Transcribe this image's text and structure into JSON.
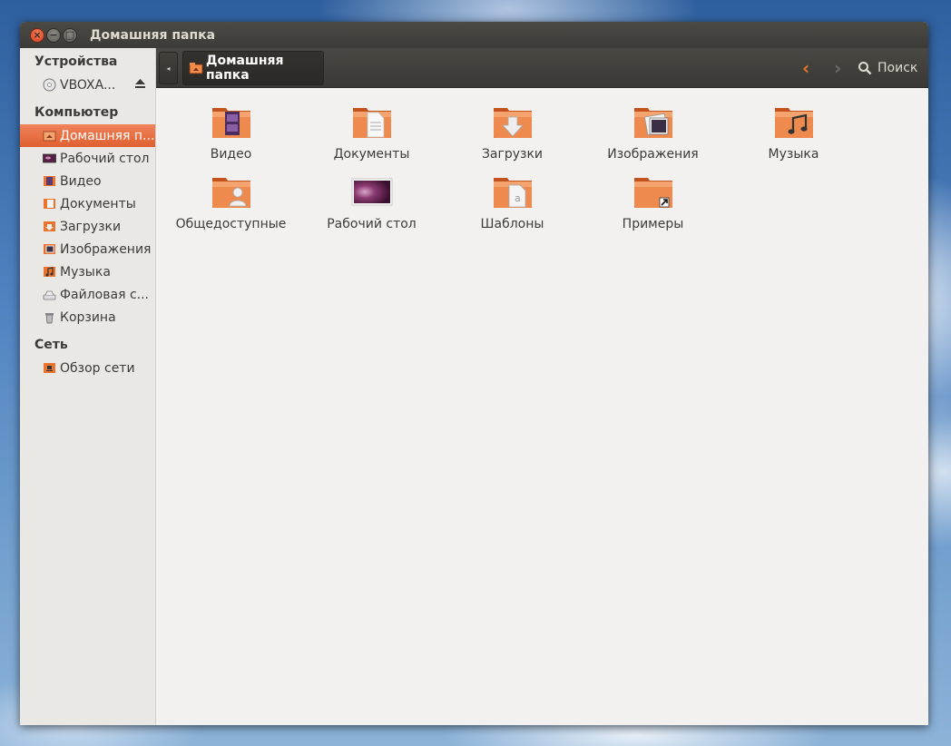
{
  "window": {
    "title": "Домашняя папка"
  },
  "sidebar": {
    "sections": {
      "devices": "Устройства",
      "computer": "Компьютер",
      "network": "Сеть"
    },
    "devices": [
      {
        "label": "VBOXA...",
        "icon": "optical-disc-icon"
      }
    ],
    "computer": [
      {
        "label": "Домашняя п...",
        "icon": "home-folder-icon",
        "selected": true
      },
      {
        "label": "Рабочий стол",
        "icon": "desktop-icon"
      },
      {
        "label": "Видео",
        "icon": "video-folder-icon"
      },
      {
        "label": "Документы",
        "icon": "documents-folder-icon"
      },
      {
        "label": "Загрузки",
        "icon": "downloads-folder-icon"
      },
      {
        "label": "Изображения",
        "icon": "pictures-folder-icon"
      },
      {
        "label": "Музыка",
        "icon": "music-folder-icon"
      },
      {
        "label": "Файловая с...",
        "icon": "filesystem-icon"
      },
      {
        "label": "Корзина",
        "icon": "trash-icon"
      }
    ],
    "network": [
      {
        "label": "Обзор сети",
        "icon": "network-folder-icon"
      }
    ]
  },
  "toolbar": {
    "breadcrumb": "Домашняя папка",
    "search_label": "Поиск"
  },
  "files": [
    {
      "label": "Видео",
      "icon": "video-folder-icon"
    },
    {
      "label": "Документы",
      "icon": "documents-folder-icon"
    },
    {
      "label": "Загрузки",
      "icon": "downloads-folder-icon"
    },
    {
      "label": "Изображения",
      "icon": "pictures-folder-icon"
    },
    {
      "label": "Музыка",
      "icon": "music-folder-icon"
    },
    {
      "label": "Общедоступные",
      "icon": "public-folder-icon"
    },
    {
      "label": "Рабочий стол",
      "icon": "desktop-folder-icon"
    },
    {
      "label": "Шаблоны",
      "icon": "templates-folder-icon"
    },
    {
      "label": "Примеры",
      "icon": "examples-folder-icon"
    }
  ],
  "colors": {
    "accent": "#e9742f",
    "selection": "#e0602f",
    "titlebar": "#3c3b37",
    "background": "#f2f1f0"
  }
}
